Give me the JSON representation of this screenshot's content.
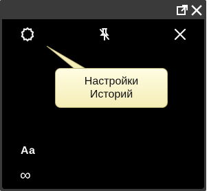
{
  "window": {
    "popout_icon": "popout-icon",
    "close_icon": "close-icon"
  },
  "toolbar": {
    "settings_icon": "gear-icon",
    "pin_icon": "unpin-icon",
    "close_icon": "close-icon"
  },
  "tooltip": {
    "text": "Настройки\nИсторий"
  },
  "bottom": {
    "font_label": "Aa",
    "infinity_label": "∞"
  },
  "colors": {
    "panel": "#000000",
    "frame": "#3a3a3a",
    "icon": "#f4f4f4",
    "tooltip_bg": "#f7efbd"
  }
}
